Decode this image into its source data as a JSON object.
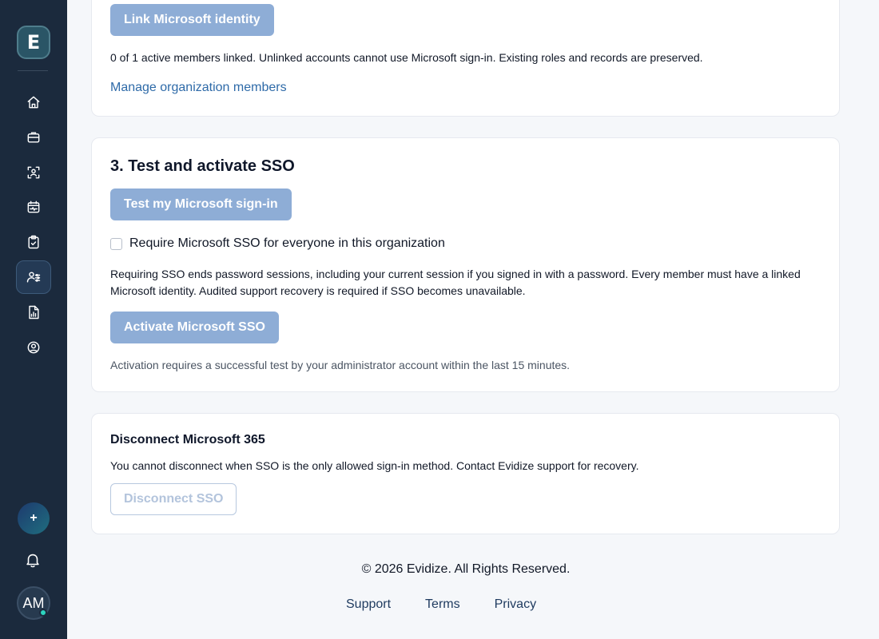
{
  "sidebar": {
    "logo_letter": "E",
    "nav": [
      {
        "name": "home",
        "icon": "home-icon"
      },
      {
        "name": "cases",
        "icon": "briefcase-icon"
      },
      {
        "name": "scan",
        "icon": "face-scan-icon"
      },
      {
        "name": "calendar",
        "icon": "calendar-icon"
      },
      {
        "name": "tasks",
        "icon": "clipboard-icon"
      },
      {
        "name": "users-settings",
        "icon": "users-sliders-icon",
        "active": true
      },
      {
        "name": "reports",
        "icon": "report-chart-icon"
      },
      {
        "name": "account",
        "icon": "user-circle-icon"
      }
    ],
    "fab_label": "+",
    "avatar_initials": "AM"
  },
  "identity_card": {
    "link_button": "Link Microsoft identity",
    "status_text": "0 of 1 active members linked. Unlinked accounts cannot use Microsoft sign-in. Existing roles and records are preserved.",
    "manage_link": "Manage organization members"
  },
  "test_card": {
    "title": "3. Test and activate SSO",
    "test_button": "Test my Microsoft sign-in",
    "require_checkbox_label": "Require Microsoft SSO for everyone in this organization",
    "require_checked": false,
    "warning_text": "Requiring SSO ends password sessions, including your current session if you signed in with a password. Every member must have a linked Microsoft identity. Audited support recovery is required if SSO becomes unavailable.",
    "activate_button": "Activate Microsoft SSO",
    "activation_note": "Activation requires a successful test by your administrator account within the last 15 minutes."
  },
  "disconnect_card": {
    "title": "Disconnect Microsoft 365",
    "note": "You cannot disconnect when SSO is the only allowed sign-in method. Contact Evidize support for recovery.",
    "disconnect_button": "Disconnect SSO"
  },
  "footer": {
    "copyright": "© 2026  Evidize. All Rights Reserved.",
    "links": [
      "Support",
      "Terms",
      "Privacy"
    ]
  },
  "colors": {
    "sidebar_bg": "#1b2a3d",
    "primary_disabled": "#8eadd6",
    "link": "#2e6aa8"
  }
}
